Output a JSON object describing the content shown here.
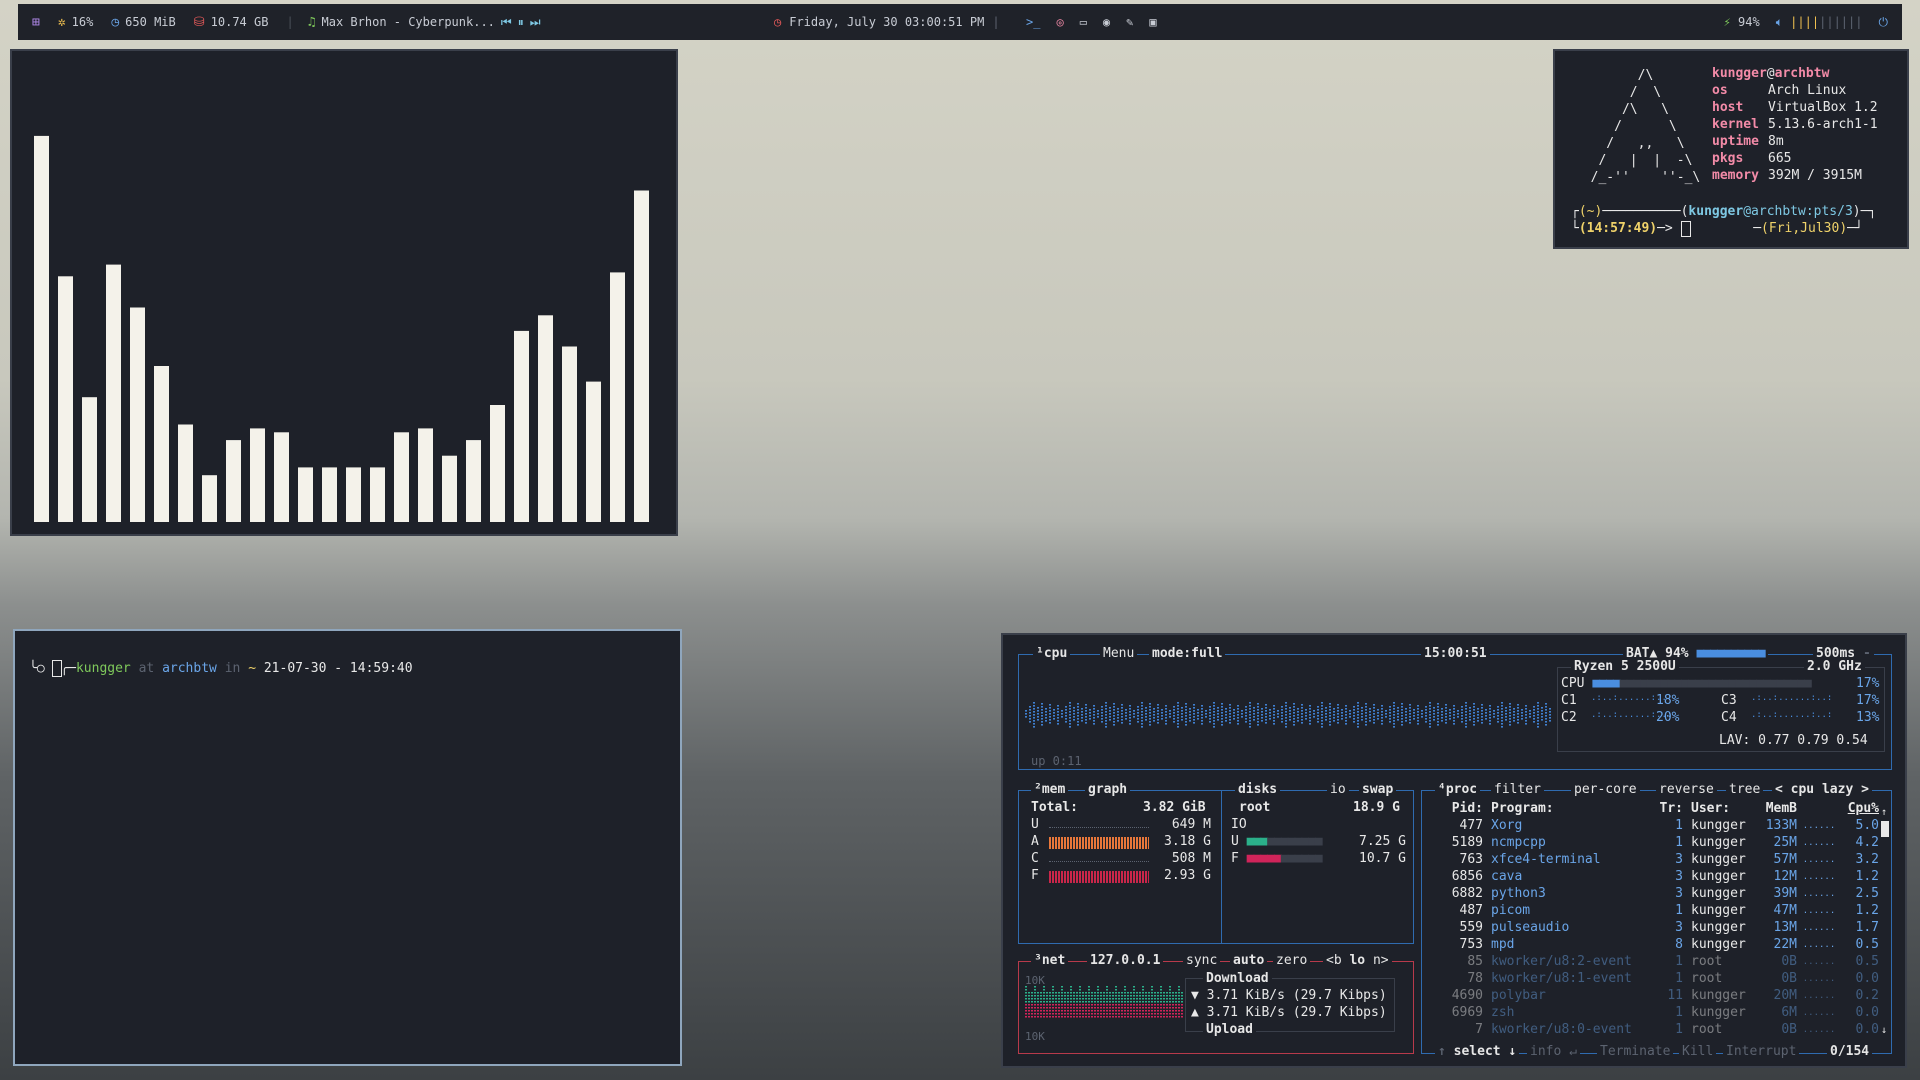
{
  "topbar": {
    "cpu": "16%",
    "mem": "650 MiB",
    "disk": "10.74 GB",
    "music": "Max Brhon - Cyberpunk...",
    "datetime": "Friday, July 30 03:00:51 PM",
    "battery": "94%",
    "volume_level": 0.4,
    "colors": {
      "accent": "#7ec8e3",
      "warn": "#f0c050",
      "red": "#e85a5a",
      "green": "#7fc95b"
    }
  },
  "cava": {
    "bar_levels": [
      0.99,
      0.63,
      0.32,
      0.66,
      0.55,
      0.4,
      0.25,
      0.12,
      0.21,
      0.24,
      0.23,
      0.14,
      0.14,
      0.14,
      0.14,
      0.23,
      0.24,
      0.17,
      0.21,
      0.3,
      0.49,
      0.53,
      0.45,
      0.36,
      0.64,
      0.85
    ]
  },
  "neofetch": {
    "logo": [
      "        /\\",
      "       /  \\",
      "      /\\   \\",
      "     /      \\",
      "    /   ,,   \\",
      "   /   |  |  -\\",
      "  /_-''    ''-_\\"
    ],
    "user": "kungger",
    "at": "@",
    "hostname": "archbtw",
    "info": [
      {
        "key": "os",
        "value": "Arch Linux"
      },
      {
        "key": "host",
        "value": "VirtualBox 1.2"
      },
      {
        "key": "kernel",
        "value": "5.13.6-arch1-1"
      },
      {
        "key": "uptime",
        "value": "8m"
      },
      {
        "key": "pkgs",
        "value": "665"
      },
      {
        "key": "memory",
        "value": "392M / 3915M"
      }
    ],
    "prompt_dir": "(~)",
    "prompt_user": "kungger",
    "prompt_host": "@archbtw:pts/3",
    "prompt_time": "(14:57:49)",
    "prompt_date": "(Fri,Jul30)"
  },
  "terminal": {
    "user": "kungger",
    "at": "at",
    "host": "archbtw",
    "in": "in",
    "dir": "~",
    "timestamp": "21-07-30 - 14:59:40"
  },
  "btop": {
    "cpu_box": {
      "num": "¹cpu",
      "menu": "Menu",
      "mode": "mode:full",
      "clock": "15:00:51",
      "bat": "BAT▲ 94%",
      "interval": "500ms",
      "uptime": "up 0:11"
    },
    "cpu_info": {
      "model": "Ryzen 5 2500U",
      "freq": "2.0 GHz",
      "total_label": "CPU",
      "total": "17%",
      "cores": [
        {
          "name": "C1",
          "val": "18%"
        },
        {
          "name": "C3",
          "val": "17%"
        },
        {
          "name": "C2",
          "val": "20%"
        },
        {
          "name": "C4",
          "val": "13%"
        }
      ],
      "lav": "LAV: 0.77 0.79 0.54"
    },
    "mem": {
      "title": "²mem",
      "graph": "graph",
      "total_label": "Total:",
      "total": "3.82 GiB",
      "rows": [
        {
          "k": "U",
          "v": "649 M"
        },
        {
          "k": "A",
          "v": "3.18 G"
        },
        {
          "k": "C",
          "v": "508 M"
        },
        {
          "k": "F",
          "v": "2.93 G"
        }
      ]
    },
    "disks": {
      "title": "disks",
      "io": "io",
      "swap": "swap",
      "root": "root",
      "size": "18.9 G",
      "io_label": "IO",
      "used_label": "U",
      "used": "7.25 G",
      "free_label": "F",
      "free": "10.7 G"
    },
    "net": {
      "title": "³net",
      "iface": "127.0.0.1",
      "sync": "sync",
      "auto": "auto",
      "zero": "zero",
      "b": "<b",
      "lo": "lo",
      "n": "n>",
      "scale_top": "10K",
      "scale_bot": "10K",
      "download_label": "Download",
      "down": "▼ 3.71 KiB/s (29.7 Kibps)",
      "up": "▲ 3.71 KiB/s (29.7 Kibps)",
      "upload_label": "Upload"
    },
    "proc": {
      "title": "⁴proc",
      "filter": "filter",
      "per_core": "per-core",
      "reverse": "reverse",
      "tree": "tree",
      "sort": "< cpu lazy >",
      "headers": {
        "pid": "Pid:",
        "program": "Program:",
        "tr": "Tr:",
        "user": "User:",
        "mem": "MemB",
        "cpu": "Cpu%"
      },
      "rows": [
        {
          "pid": "477",
          "program": "Xorg",
          "tr": "1",
          "user": "kungger",
          "mem": "133M",
          "cpu": "5.0"
        },
        {
          "pid": "5189",
          "program": "ncmpcpp",
          "tr": "1",
          "user": "kungger",
          "mem": "25M",
          "cpu": "4.2"
        },
        {
          "pid": "763",
          "program": "xfce4-terminal",
          "tr": "3",
          "user": "kungger",
          "mem": "57M",
          "cpu": "3.2"
        },
        {
          "pid": "6856",
          "program": "cava",
          "tr": "3",
          "user": "kungger",
          "mem": "12M",
          "cpu": "1.2"
        },
        {
          "pid": "6882",
          "program": "python3",
          "tr": "3",
          "user": "kungger",
          "mem": "39M",
          "cpu": "2.5"
        },
        {
          "pid": "487",
          "program": "picom",
          "tr": "1",
          "user": "kungger",
          "mem": "47M",
          "cpu": "1.2"
        },
        {
          "pid": "559",
          "program": "pulseaudio",
          "tr": "3",
          "user": "kungger",
          "mem": "13M",
          "cpu": "1.7"
        },
        {
          "pid": "753",
          "program": "mpd",
          "tr": "8",
          "user": "kungger",
          "mem": "22M",
          "cpu": "0.5"
        },
        {
          "pid": "85",
          "program": "kworker/u8:2-event",
          "tr": "1",
          "user": "root",
          "mem": "0B",
          "cpu": "0.5"
        },
        {
          "pid": "78",
          "program": "kworker/u8:1-event",
          "tr": "1",
          "user": "root",
          "mem": "0B",
          "cpu": "0.0"
        },
        {
          "pid": "4690",
          "program": "polybar",
          "tr": "11",
          "user": "kungger",
          "mem": "20M",
          "cpu": "0.2"
        },
        {
          "pid": "6969",
          "program": "zsh",
          "tr": "1",
          "user": "kungger",
          "mem": "6M",
          "cpu": "0.0"
        },
        {
          "pid": "7",
          "program": "kworker/u8:0-event",
          "tr": "1",
          "user": "root",
          "mem": "0B",
          "cpu": "0.0"
        }
      ],
      "footer": {
        "select": "select ↓",
        "info": "info ↵",
        "terminate": "Terminate",
        "kill": "Kill",
        "interrupt": "Interrupt",
        "count": "0/154"
      }
    }
  }
}
